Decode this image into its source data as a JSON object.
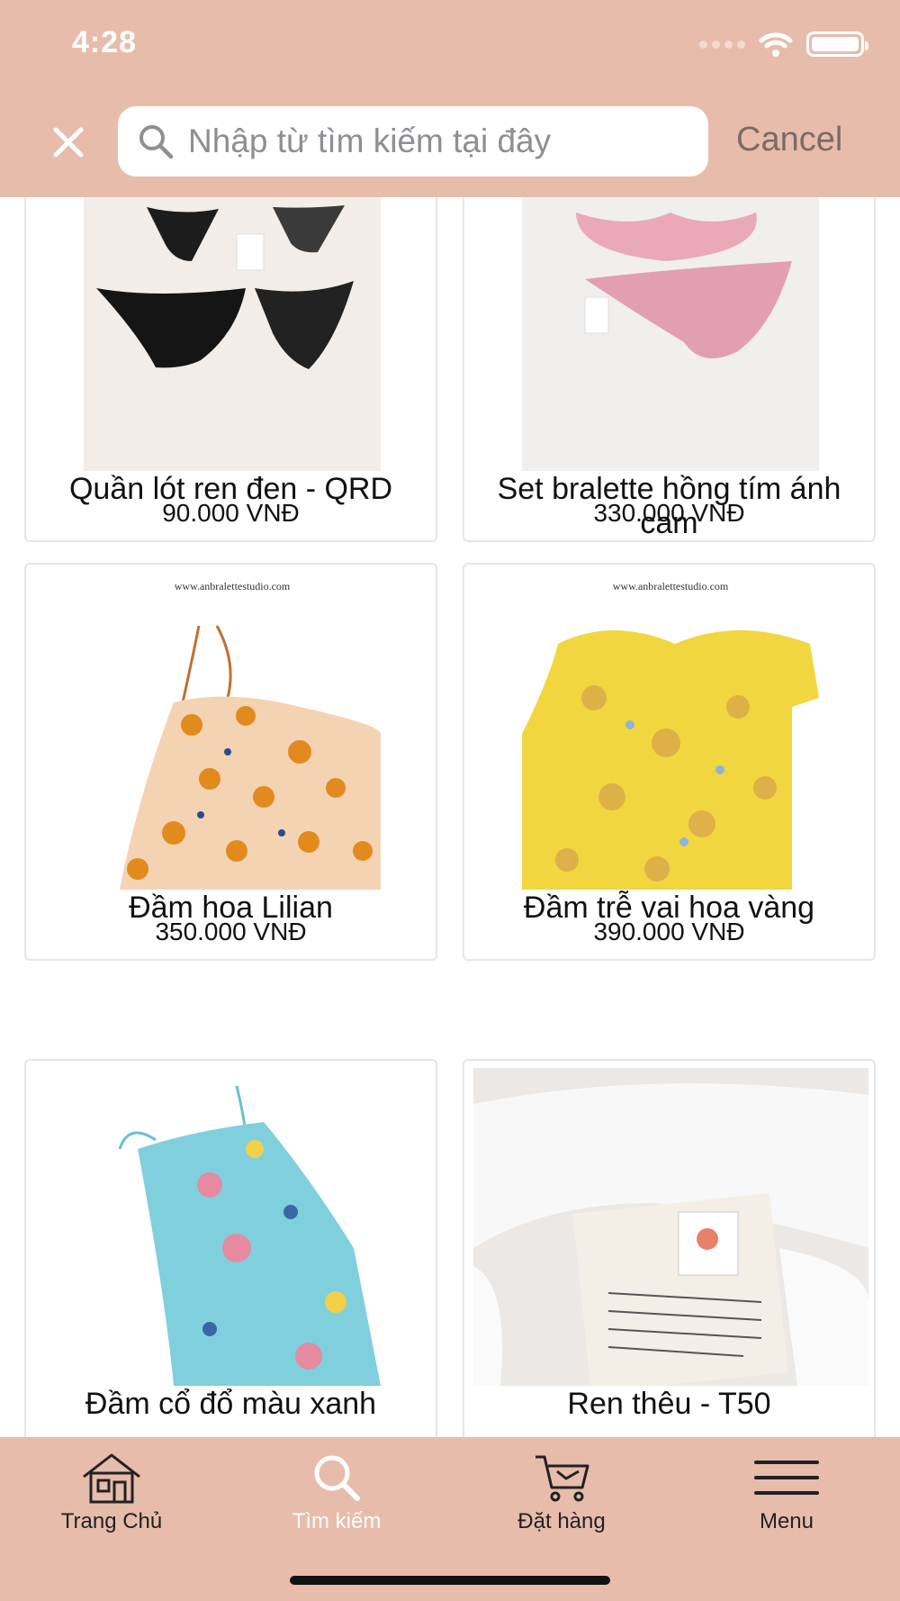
{
  "status": {
    "time": "4:28"
  },
  "search": {
    "placeholder": "Nhập từ tìm kiếm tại đây",
    "cancel_label": "Cancel"
  },
  "colors": {
    "accent": "#e8bcab",
    "active_tab": "#ffffff"
  },
  "products": [
    {
      "title": "Quần lót ren đen - QRD",
      "price": "90.000 VNĐ",
      "image": "black-lace-underwear"
    },
    {
      "title": "Set bralette hồng tím ánh cam",
      "price": "330.000 VNĐ",
      "image": "pink-bralette-set"
    },
    {
      "title": "Đầm hoa Lilian",
      "price": "350.000 VNĐ",
      "image": "orange-floral-dress"
    },
    {
      "title": "Đầm trễ vai hoa vàng",
      "price": "390.000 VNĐ",
      "image": "yellow-floral-dress"
    },
    {
      "title": "Đầm cổ đổ màu xanh",
      "price": "",
      "image": "blue-floral-dress"
    },
    {
      "title": "Ren thêu - T50",
      "price": "",
      "image": "white-lace-fabric"
    }
  ],
  "tabs": [
    {
      "label": "Trang Chủ",
      "icon": "home-icon",
      "active": false
    },
    {
      "label": "Tìm kiếm",
      "icon": "search-icon",
      "active": true
    },
    {
      "label": "Đặt hàng",
      "icon": "cart-icon",
      "active": false
    },
    {
      "label": "Menu",
      "icon": "menu-icon",
      "active": false
    }
  ]
}
